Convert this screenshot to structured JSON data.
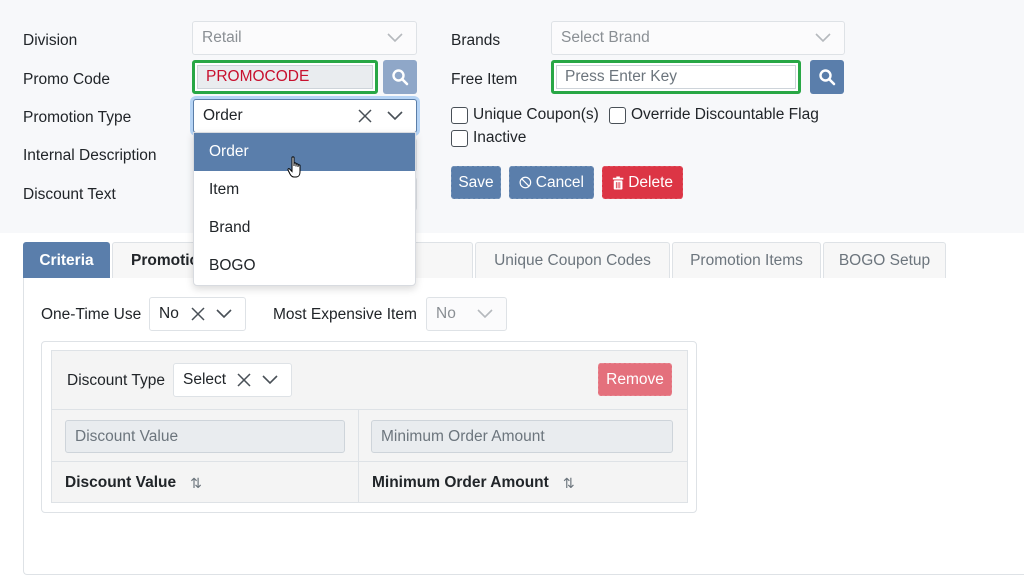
{
  "form": {
    "division": {
      "label": "Division",
      "value": "Retail"
    },
    "promo_code": {
      "label": "Promo Code",
      "value": "PROMOCODE"
    },
    "promotion_type": {
      "label": "Promotion Type",
      "value": "Order"
    },
    "internal_description": {
      "label": "Internal Description"
    },
    "discount_text": {
      "label": "Discount Text"
    },
    "brands": {
      "label": "Brands",
      "placeholder": "Select Brand"
    },
    "free_item": {
      "label": "Free Item",
      "placeholder": "Press Enter Key"
    },
    "checkboxes": [
      {
        "label": "Unique Coupon(s)",
        "checked": false
      },
      {
        "label": "Override Discountable Flag",
        "checked": false
      },
      {
        "label": "Inactive",
        "checked": false
      }
    ]
  },
  "actions": {
    "save": "Save",
    "cancel": "Cancel",
    "delete": "Delete"
  },
  "promotion_type_dropdown": {
    "options": [
      "Order",
      "Item",
      "Brand",
      "BOGO"
    ],
    "highlighted": "Order"
  },
  "tabs": [
    {
      "label": "Criteria",
      "active": true
    },
    {
      "label": "Promotion Date Range",
      "active": false
    },
    {
      "label": "Unique Coupon Codes",
      "active": false
    },
    {
      "label": "Promotion Items",
      "active": false
    },
    {
      "label": "BOGO Setup",
      "active": false
    }
  ],
  "criteria": {
    "one_time_use": {
      "label": "One-Time Use",
      "value": "No"
    },
    "most_expensive_item": {
      "label": "Most Expensive Item",
      "value": "No"
    },
    "discount_type": {
      "label": "Discount Type",
      "value": "Select"
    },
    "remove": "Remove",
    "table": {
      "filters": [
        {
          "placeholder": "Discount Value"
        },
        {
          "placeholder": "Minimum Order Amount"
        }
      ],
      "columns": [
        "Discount Value",
        "Minimum Order Amount"
      ],
      "sort_icon": "⇅",
      "rows": []
    }
  },
  "colors": {
    "primary": "#5a7eab",
    "danger": "#dc3545",
    "highlight_border": "#28a745",
    "promo_code_text": "#c8102e"
  }
}
